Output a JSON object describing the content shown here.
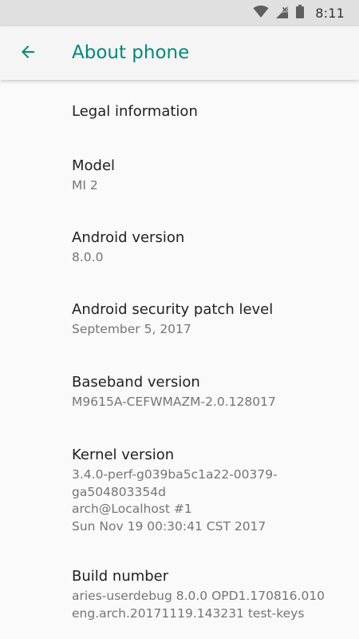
{
  "status_bar": {
    "time": "8:11",
    "icons": [
      "wifi-icon",
      "cellular-no-signal-icon",
      "battery-icon"
    ]
  },
  "app_bar": {
    "title": "About phone",
    "back_icon": "arrow-left-icon"
  },
  "colors": {
    "accent": "#00897b",
    "status_bar_bg": "#e0e0e0",
    "app_bar_bg": "#f5f5f5",
    "background": "#fafafa",
    "title_text": "#212121",
    "summary_text": "#757575"
  },
  "items": [
    {
      "title": "Legal information",
      "summary": ""
    },
    {
      "title": "Model",
      "summary": "MI 2"
    },
    {
      "title": "Android version",
      "summary": "8.0.0"
    },
    {
      "title": "Android security patch level",
      "summary": "September 5, 2017"
    },
    {
      "title": "Baseband version",
      "summary": "M9615A-CEFWMAZM-2.0.128017"
    },
    {
      "title": "Kernel version",
      "summary": "3.4.0-perf-g039ba5c1a22-00379-\nga504803354d\narch@Localhost #1\nSun Nov 19 00:30:41 CST 2017"
    },
    {
      "title": "Build number",
      "summary": "aries-userdebug 8.0.0 OPD1.170816.010\neng.arch.20171119.143231 test-keys"
    }
  ]
}
